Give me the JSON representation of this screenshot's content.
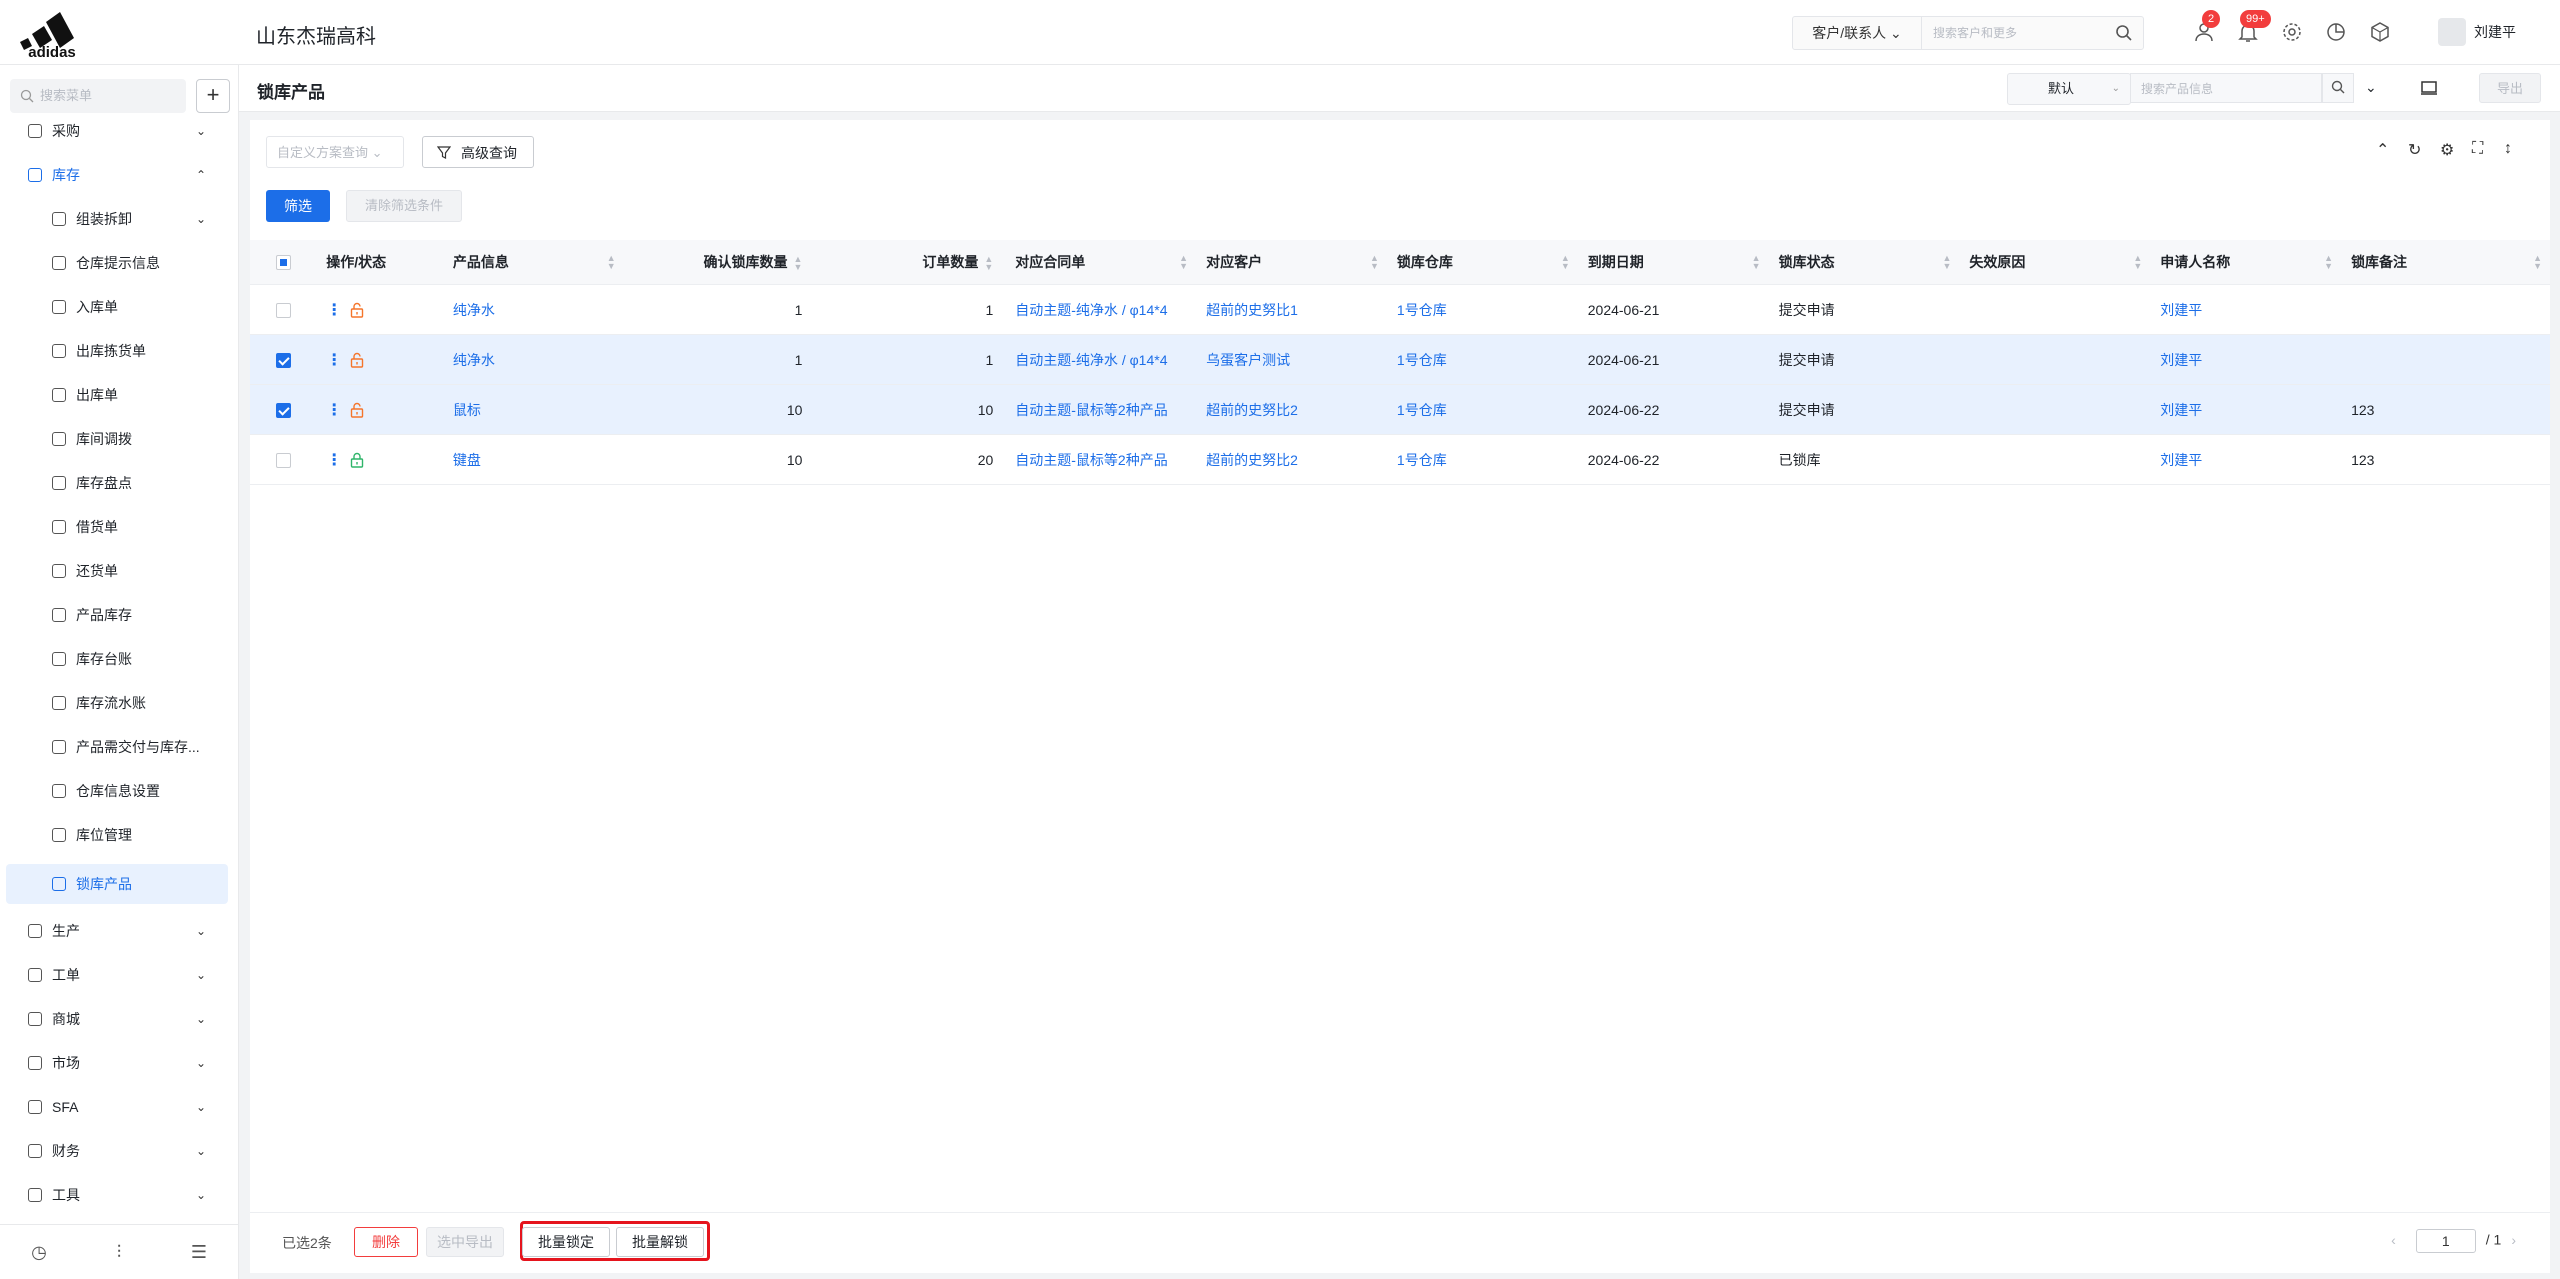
{
  "app": {
    "company": "山东杰瑞高科",
    "search_scope": "客户/联系人",
    "search_placeholder": "搜索客户和更多",
    "badge_user": "2",
    "badge_bell": "99+",
    "username": "刘建平"
  },
  "sidebar": {
    "search_placeholder": "搜索菜单",
    "items": [
      {
        "label": "采购"
      },
      {
        "label": "库存"
      },
      {
        "label": "组装拆卸"
      },
      {
        "label": "仓库提示信息"
      },
      {
        "label": "入库单"
      },
      {
        "label": "出库拣货单"
      },
      {
        "label": "出库单"
      },
      {
        "label": "库间调拨"
      },
      {
        "label": "库存盘点"
      },
      {
        "label": "借货单"
      },
      {
        "label": "还货单"
      },
      {
        "label": "产品库存"
      },
      {
        "label": "库存台账"
      },
      {
        "label": "库存流水账"
      },
      {
        "label": "产品需交付与库存..."
      },
      {
        "label": "仓库信息设置"
      },
      {
        "label": "库位管理"
      },
      {
        "label": "锁库产品"
      },
      {
        "label": "生产"
      },
      {
        "label": "工单"
      },
      {
        "label": "商城"
      },
      {
        "label": "市场"
      },
      {
        "label": "SFA"
      },
      {
        "label": "财务"
      },
      {
        "label": "工具"
      }
    ]
  },
  "page": {
    "title": "锁库产品",
    "view_select": "默认",
    "search_placeholder": "搜索产品信息",
    "export": "导出",
    "scheme_placeholder": "自定义方案查询",
    "advanced_query": "高级查询",
    "filter": "筛选",
    "clear_filter": "清除筛选条件"
  },
  "table": {
    "headers": {
      "ops": "操作/状态",
      "product": "产品信息",
      "confirm_qty": "确认锁库数量",
      "order_qty": "订单数量",
      "contract": "对应合同单",
      "customer": "对应客户",
      "warehouse": "锁库仓库",
      "due": "到期日期",
      "status": "锁库状态",
      "reason": "失效原因",
      "applicant": "申请人名称",
      "note": "锁库备注"
    },
    "rows": [
      {
        "product": "纯净水",
        "confirm_qty": "1",
        "order_qty": "1",
        "contract": "自动主题-纯净水 / φ14*4",
        "customer": "超前的史努比1",
        "warehouse": "1号仓库",
        "due": "2024-06-21",
        "status": "提交申请",
        "reason": "",
        "applicant": "刘建平",
        "note": ""
      },
      {
        "product": "纯净水",
        "confirm_qty": "1",
        "order_qty": "1",
        "contract": "自动主题-纯净水 / φ14*4",
        "customer": "乌蛋客户测试",
        "warehouse": "1号仓库",
        "due": "2024-06-21",
        "status": "提交申请",
        "reason": "",
        "applicant": "刘建平",
        "note": ""
      },
      {
        "product": "鼠标",
        "confirm_qty": "10",
        "order_qty": "10",
        "contract": "自动主题-鼠标等2种产品",
        "customer": "超前的史努比2",
        "warehouse": "1号仓库",
        "due": "2024-06-22",
        "status": "提交申请",
        "reason": "",
        "applicant": "刘建平",
        "note": "123"
      },
      {
        "product": "键盘",
        "confirm_qty": "10",
        "order_qty": "20",
        "contract": "自动主题-鼠标等2种产品",
        "customer": "超前的史努比2",
        "warehouse": "1号仓库",
        "due": "2024-06-22",
        "status": "已锁库",
        "reason": "",
        "applicant": "刘建平",
        "note": "123"
      }
    ]
  },
  "footer": {
    "selected": "已选2条",
    "delete": "删除",
    "export_selected": "选中导出",
    "batch_lock": "批量锁定",
    "batch_unlock": "批量解锁",
    "page": "1",
    "total": "/ 1"
  },
  "colors": {
    "accent": "#1c6ee8",
    "danger": "#f23d3d",
    "lock_open": "#f5752b",
    "lock_closed": "#2fb56a"
  }
}
